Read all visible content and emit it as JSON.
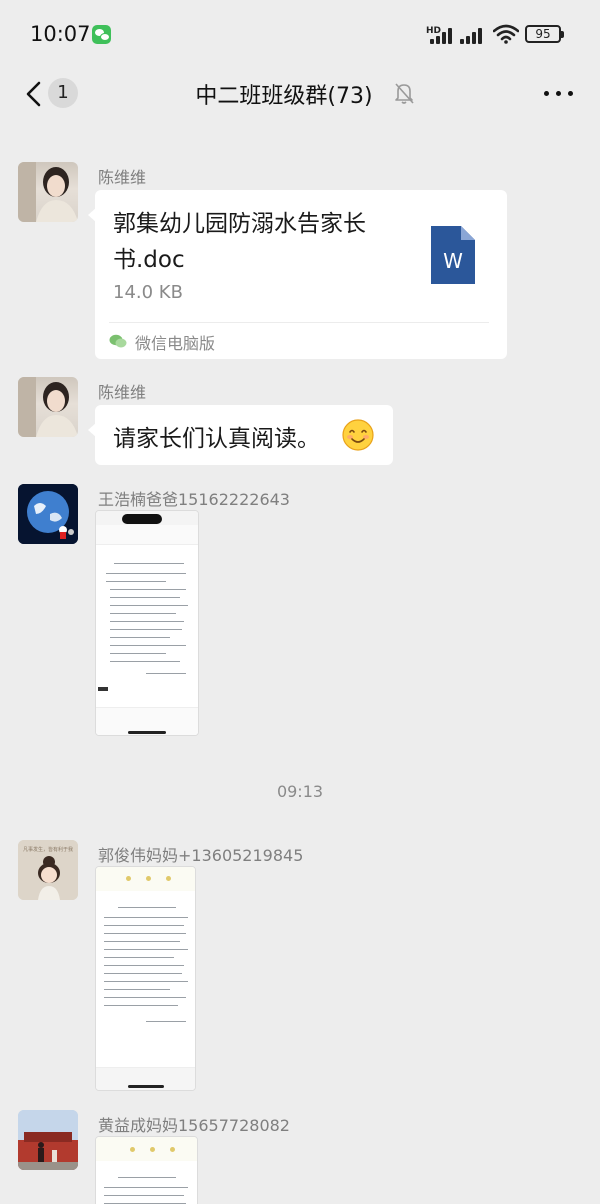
{
  "status_bar": {
    "time": "10:07",
    "hd": "HD",
    "battery": "95"
  },
  "nav": {
    "unread_count": "1",
    "title": "中二班班级群(73)"
  },
  "messages": [
    {
      "sender": "陈维维",
      "file_name": "郭集幼儿园防溺水告家长书.doc",
      "file_size": "14.0 KB",
      "source": "微信电脑版",
      "icon": "word-file-icon"
    },
    {
      "sender": "陈维维",
      "text": "请家长们认真阅读。",
      "emoji": "smile-icon"
    },
    {
      "sender": "王浩楠爸爸15162222643",
      "type": "image"
    },
    {
      "sender": "郭俊伟妈妈+13605219845",
      "type": "image"
    },
    {
      "sender": "黄益成妈妈15657728082",
      "type": "image"
    }
  ],
  "timestamp": "09:13",
  "avatar_caption": "凡事发生，皆有利于我",
  "colors": {
    "background": "#ededed",
    "bubble": "#ffffff",
    "wechat_green": "#3fc05a",
    "word_blue": "#2b579a"
  }
}
